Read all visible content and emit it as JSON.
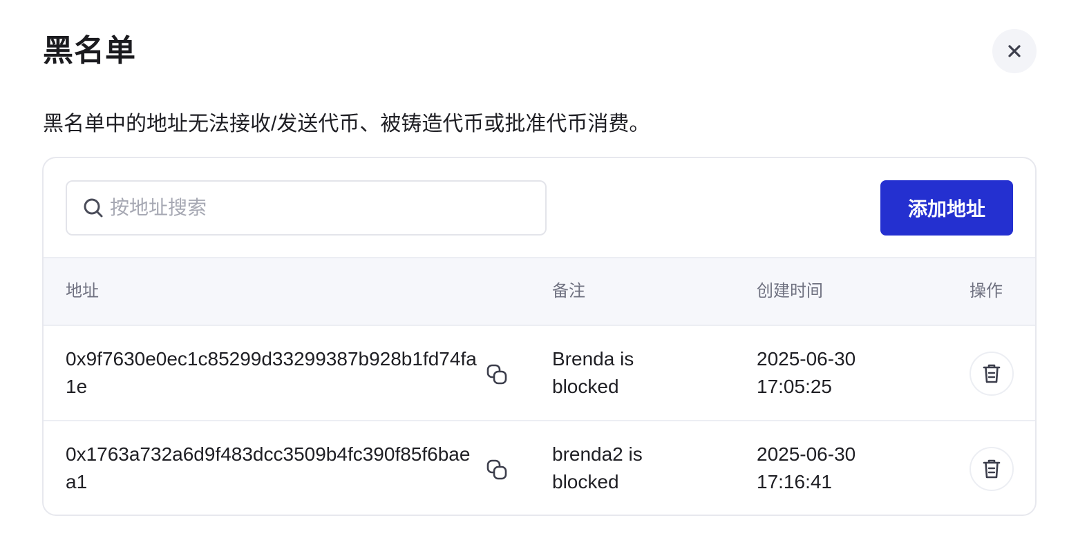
{
  "dialog": {
    "title": "黑名单",
    "description": "黑名单中的地址无法接收/发送代币、被铸造代币或批准代币消费。",
    "close_icon": "close-icon"
  },
  "search": {
    "placeholder": "按地址搜索",
    "value": "",
    "icon": "search-icon"
  },
  "add_button": {
    "label": "添加地址"
  },
  "table": {
    "headers": {
      "address": "地址",
      "note": "备注",
      "created": "创建时间",
      "actions": "操作"
    },
    "rows": [
      {
        "address": "0x9f7630e0ec1c85299d33299387b928b1fd74fa1e",
        "note": "Brenda is blocked",
        "created": "2025-06-30 17:05:25"
      },
      {
        "address": "0x1763a732a6d9f483dcc3509b4fc390f85f6baea1",
        "note": "brenda2 is blocked",
        "created": "2025-06-30 17:16:41"
      }
    ]
  },
  "colors": {
    "accent": "#2430d0",
    "header_bg": "#f6f7fb",
    "border": "#e7e8ee",
    "muted_text": "#6f7180",
    "placeholder": "#a6a8b3"
  }
}
